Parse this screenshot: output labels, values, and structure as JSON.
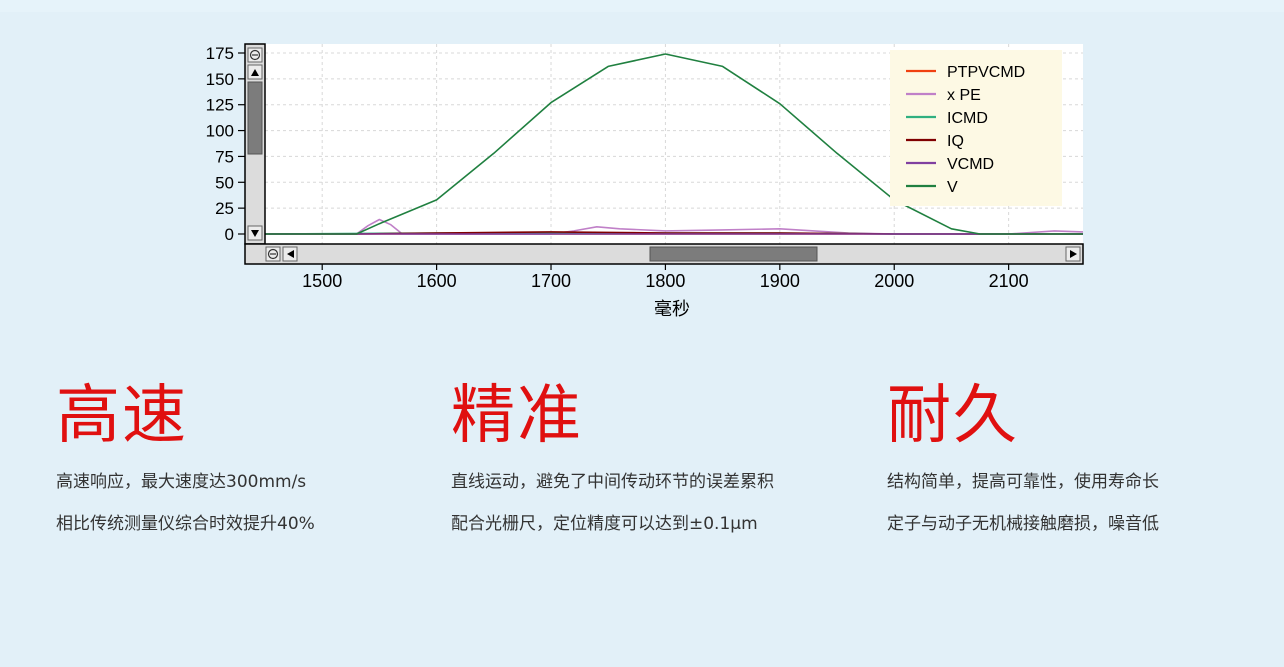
{
  "chart_data": {
    "type": "line",
    "xlabel": "毫秒",
    "ylabel": "",
    "xlim": [
      1450,
      2165
    ],
    "ylim": [
      0,
      180
    ],
    "x_ticks": [
      1500,
      1600,
      1700,
      1800,
      1900,
      2000,
      2100
    ],
    "y_ticks": [
      0,
      25,
      50,
      75,
      100,
      125,
      150,
      175
    ],
    "grid": true,
    "legend_position": "top-right",
    "series": [
      {
        "name": "PTPVCMD",
        "color": "#f04010",
        "x": [
          1450,
          2165
        ],
        "y": [
          0,
          0
        ]
      },
      {
        "name": "x PE",
        "color": "#c080c8",
        "x": [
          1450,
          1530,
          1540,
          1550,
          1560,
          1570,
          1600,
          1700,
          1720,
          1740,
          1760,
          1800,
          1850,
          1900,
          1930,
          1960,
          2000,
          2100,
          2140,
          2165
        ],
        "y": [
          0,
          0,
          8,
          14,
          9,
          0,
          0,
          0,
          3,
          7,
          5,
          3,
          4,
          5,
          3,
          1,
          0,
          0,
          3,
          2
        ]
      },
      {
        "name": "ICMD",
        "color": "#30b080",
        "x": [
          1450,
          1600,
          1700,
          1800,
          1900,
          2000,
          2165
        ],
        "y": [
          0,
          1,
          1,
          1,
          1,
          0,
          0
        ]
      },
      {
        "name": "IQ",
        "color": "#800000",
        "x": [
          1450,
          1530,
          1600,
          1700,
          1800,
          1900,
          2000,
          2165
        ],
        "y": [
          0,
          0,
          1,
          2,
          1,
          1,
          0,
          0
        ]
      },
      {
        "name": "VCMD",
        "color": "#8040a0",
        "x": [
          1450,
          2165
        ],
        "y": [
          0,
          0
        ]
      },
      {
        "name": "V",
        "color": "#208040",
        "x": [
          1450,
          1530,
          1550,
          1600,
          1650,
          1700,
          1750,
          1800,
          1850,
          1900,
          1950,
          2000,
          2050,
          2075,
          2165
        ],
        "y": [
          0,
          0,
          10,
          33,
          78,
          127,
          162,
          174,
          162,
          126,
          78,
          33,
          5,
          0,
          0
        ]
      }
    ]
  },
  "features": [
    {
      "title": "高速",
      "line1": "高速响应，最大速度达300mm/s",
      "line2": "相比传统测量仪综合时效提升40%"
    },
    {
      "title": "精准",
      "line1": "直线运动，避免了中间传动环节的误差累积",
      "line2": "配合光栅尺，定位精度可以达到±0.1μm"
    },
    {
      "title": "耐久",
      "line1": "结构简单，提高可靠性，使用寿命长",
      "line2": "定子与动子无机械接触磨损，噪音低"
    }
  ]
}
